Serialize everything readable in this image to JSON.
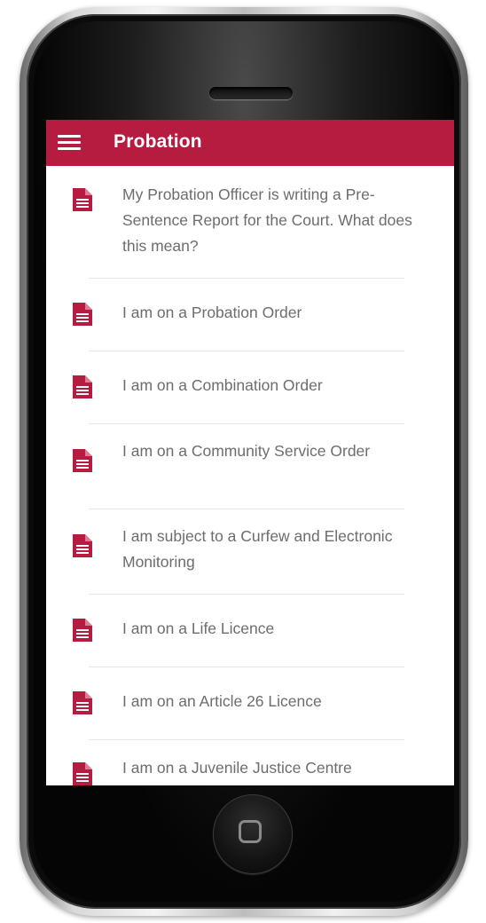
{
  "app_bar": {
    "title": "Probation",
    "color": "#b51c40"
  },
  "icons": {
    "menu": "hamburger-menu-icon",
    "list_item": "document-icon",
    "home": "home-button-icon"
  },
  "list": {
    "items": [
      {
        "label": "My Probation Officer is writing a Pre-Sentence Report for the Court. What does this mean?"
      },
      {
        "label": "I am on a Probation Order"
      },
      {
        "label": "I am on a Combination Order"
      },
      {
        "label": "I am on a Community Service Order"
      },
      {
        "label": "I am subject to a Curfew and Electronic Monitoring"
      },
      {
        "label": "I am on a Life Licence"
      },
      {
        "label": "I am on an Article 26 Licence"
      },
      {
        "label": "I am on a Juvenile Justice Centre"
      }
    ]
  }
}
